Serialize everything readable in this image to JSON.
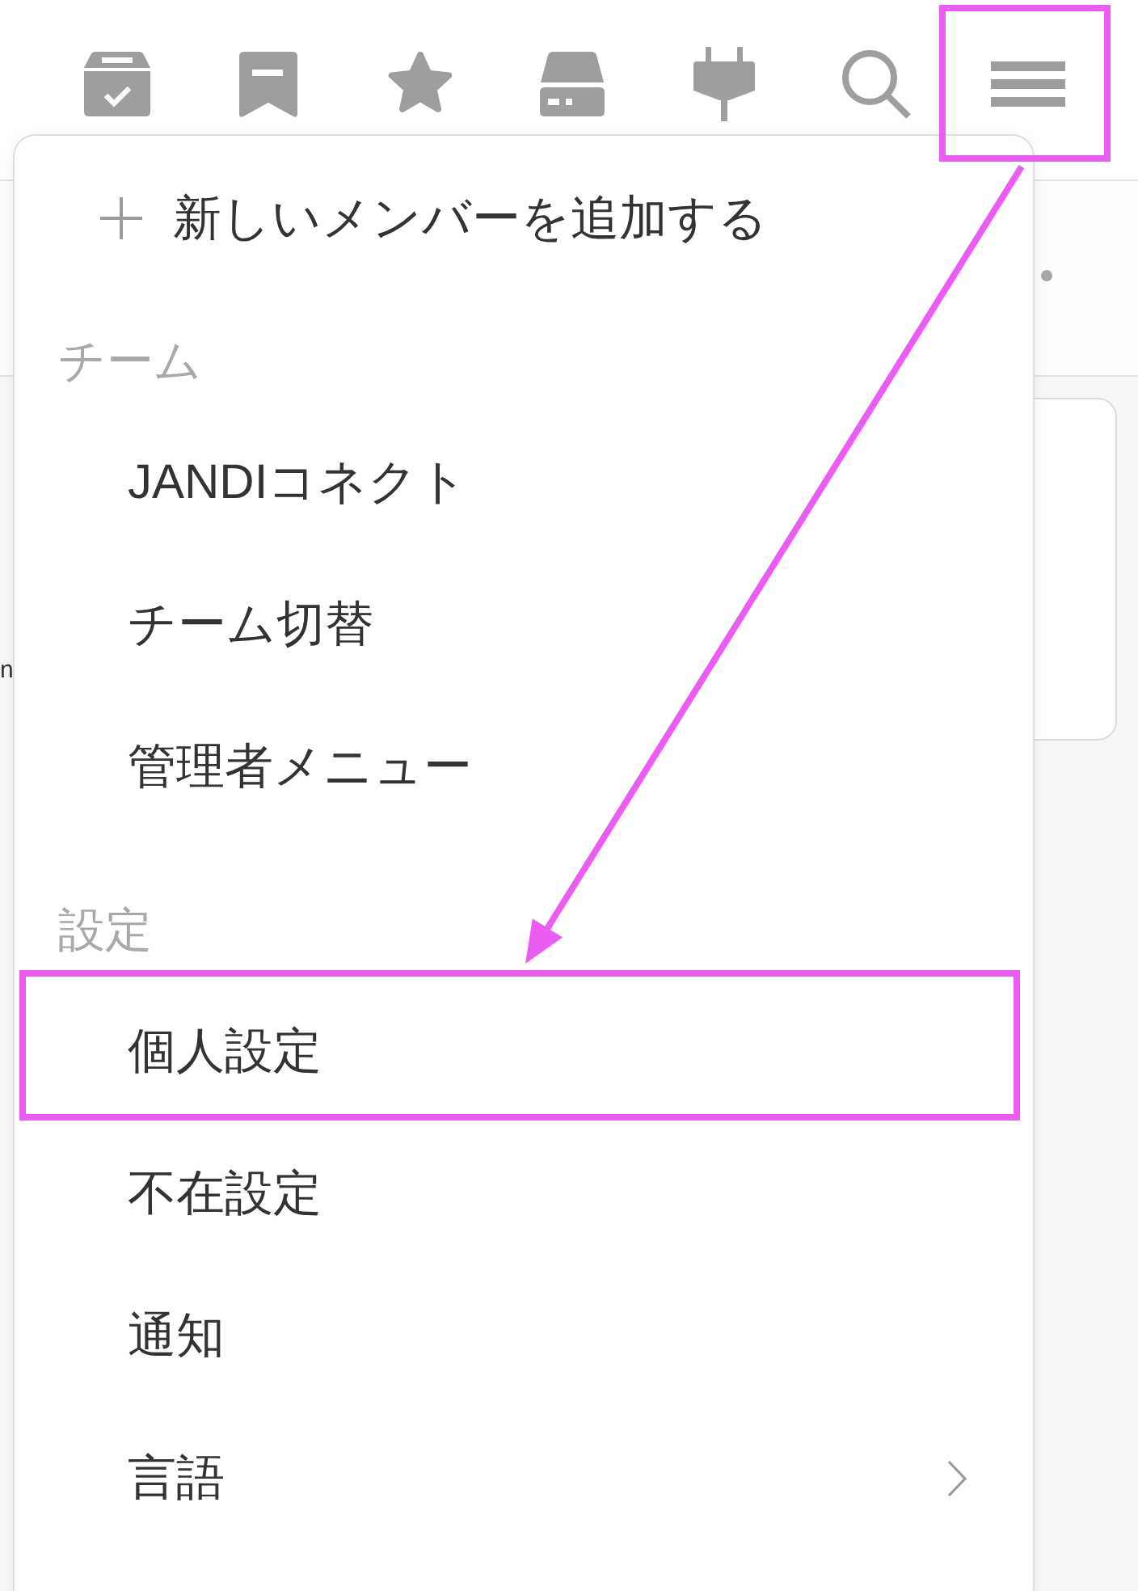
{
  "toolbar": [
    {
      "kind": "archive",
      "highlighted": false
    },
    {
      "kind": "bookmark",
      "highlighted": false
    },
    {
      "kind": "star",
      "highlighted": false
    },
    {
      "kind": "drive",
      "highlighted": false
    },
    {
      "kind": "plug",
      "highlighted": false
    },
    {
      "kind": "search",
      "highlighted": false
    },
    {
      "kind": "menu",
      "highlighted": true
    }
  ],
  "background": {
    "text_fragment": "n"
  },
  "menu": {
    "add_member": {
      "label": "新しいメンバーを追加する"
    },
    "sections": [
      {
        "title": "チーム",
        "items": [
          {
            "label": "JANDIコネクト",
            "highlighted": false,
            "submenu": false
          },
          {
            "label": "チーム切替",
            "highlighted": false,
            "submenu": false
          },
          {
            "label": "管理者メニュー",
            "highlighted": false,
            "submenu": false
          }
        ]
      },
      {
        "title": "設定",
        "items": [
          {
            "label": "個人設定",
            "highlighted": true,
            "submenu": false
          },
          {
            "label": "不在設定",
            "highlighted": false,
            "submenu": false
          },
          {
            "label": "通知",
            "highlighted": false,
            "submenu": false
          },
          {
            "label": "言語",
            "highlighted": false,
            "submenu": true
          }
        ]
      }
    ]
  }
}
